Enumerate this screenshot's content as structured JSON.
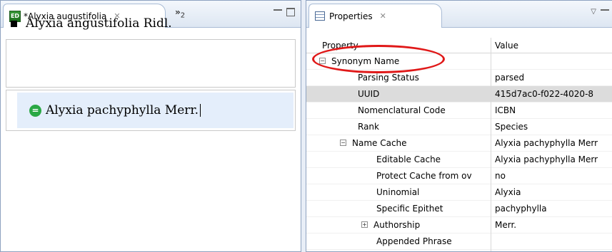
{
  "editor": {
    "tab_label": "*Alyxia augustifolia",
    "icon": "ed-icon",
    "overflow_label": "»",
    "overflow_count": "2",
    "accepted_name": "Alyxia angustifolia Ridl.",
    "synonym_name": "Alyxia pachyphylla Merr."
  },
  "properties": {
    "tab_label": "Properties",
    "column_property": "Property",
    "column_value": "Value",
    "rows": [
      {
        "property": "Synonym Name",
        "value": "",
        "toggle": "−"
      },
      {
        "property": "Parsing Status",
        "value": "parsed"
      },
      {
        "property": "UUID",
        "value": "415d7ac0-f022-4020-8"
      },
      {
        "property": "Nomenclatural Code",
        "value": "ICBN"
      },
      {
        "property": "Rank",
        "value": "Species"
      },
      {
        "property": "Name Cache",
        "value": "Alyxia pachyphylla Merr",
        "toggle": "−"
      },
      {
        "property": "Editable Cache",
        "value": "Alyxia pachyphylla Merr"
      },
      {
        "property": "Protect Cache from ov",
        "value": "no"
      },
      {
        "property": "Uninomial",
        "value": "Alyxia"
      },
      {
        "property": "Specific Epithet",
        "value": "pachyphylla"
      },
      {
        "property": "Authorship",
        "value": "Merr.",
        "toggle": "+"
      },
      {
        "property": "Appended Phrase",
        "value": ""
      }
    ]
  },
  "annotation": {
    "color": "#e01818"
  }
}
